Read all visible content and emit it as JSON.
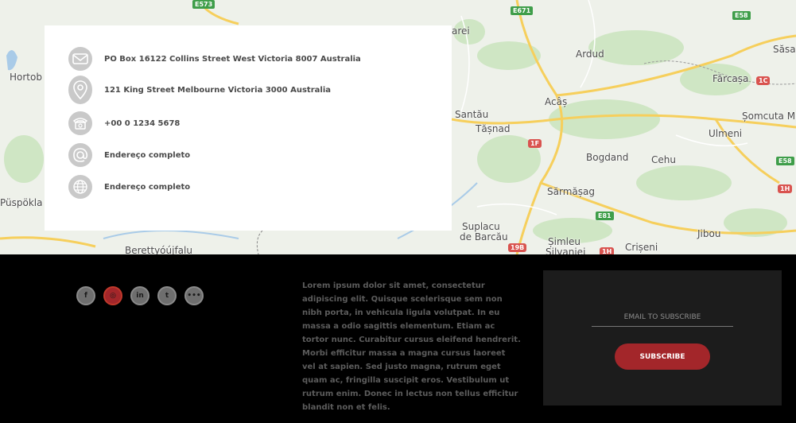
{
  "map": {
    "places": [
      {
        "id": "hortobagy",
        "label": "Hortob"
      },
      {
        "id": "puspokladany",
        "label": "Püspökla"
      },
      {
        "id": "berettyoujfalu",
        "label": "Berettyóújfalu"
      },
      {
        "id": "ardud",
        "label": "Ardud"
      },
      {
        "id": "farcasa",
        "label": "Fărcașa"
      },
      {
        "id": "sasar",
        "label": "Săsa"
      },
      {
        "id": "somcuta",
        "label": "Șomcuta M"
      },
      {
        "id": "ulmeni",
        "label": "Ulmeni"
      },
      {
        "id": "acas",
        "label": "Acâș"
      },
      {
        "id": "santau",
        "label": "Santău"
      },
      {
        "id": "tasnad",
        "label": "Tășnad"
      },
      {
        "id": "bogdand",
        "label": "Bogdand"
      },
      {
        "id": "cehu",
        "label": "Cehu"
      },
      {
        "id": "sarmasag",
        "label": "Sărmășag"
      },
      {
        "id": "suplacu",
        "label": "Suplacu"
      },
      {
        "id": "debarcau",
        "label": "de Barcău"
      },
      {
        "id": "simleu",
        "label": "Șimleu"
      },
      {
        "id": "silvaniei",
        "label": "Silvaniei"
      },
      {
        "id": "criseni",
        "label": "Crișeni"
      },
      {
        "id": "jibou",
        "label": "Jibou"
      },
      {
        "id": "arei",
        "label": "arei"
      }
    ],
    "roads": {
      "e573": "E573",
      "e671": "E671",
      "e58a": "E58",
      "e58b": "E58",
      "e81": "E81",
      "r1c": "1C",
      "r1f": "1F",
      "r1h": "1H",
      "r19b": "19B",
      "r1h2": "1H"
    }
  },
  "contact": {
    "items": [
      {
        "icon": "envelope-icon",
        "text": "PO Box 16122 Collins Street West Victoria 8007 Australia"
      },
      {
        "icon": "location-pin-icon",
        "text": "121 King Street Melbourne Victoria 3000 Australia"
      },
      {
        "icon": "phone-icon",
        "text": "+00 0 1234 5678"
      },
      {
        "icon": "at-sign-icon",
        "text": "Endereço completo"
      },
      {
        "icon": "globe-icon",
        "text": "Endereço completo"
      }
    ]
  },
  "footer": {
    "social": [
      {
        "icon": "facebook-icon",
        "glyph": "f"
      },
      {
        "icon": "instagram-icon",
        "glyph": "◎"
      },
      {
        "icon": "linkedin-icon",
        "glyph": "in"
      },
      {
        "icon": "twitter-icon",
        "glyph": "t"
      },
      {
        "icon": "flickr-icon",
        "glyph": "•••"
      }
    ],
    "about_text": "Lorem ipsum dolor sit amet, consectetur adipiscing elit. Quisque scelerisque sem non nibh porta, in vehicula ligula volutpat. In eu massa a odio sagittis elementum. Etiam ac tortor nunc. Curabitur cursus eleifend hendrerit. Morbi efficitur massa a magna cursus laoreet vel at sapien. Sed justo magna, rutrum eget quam ac, fringilla suscipit eros. Vestibulum ut rutrum enim. Donec in lectus non tellus efficitur blandit non et felis.",
    "subscribe": {
      "placeholder": "EMAIL TO SUBSCRIBE",
      "button_label": "SUBSCRIBE"
    }
  },
  "colors": {
    "accent": "#a3262a",
    "footer_bg": "#000000",
    "subscribe_bg": "#1c1c1c"
  }
}
